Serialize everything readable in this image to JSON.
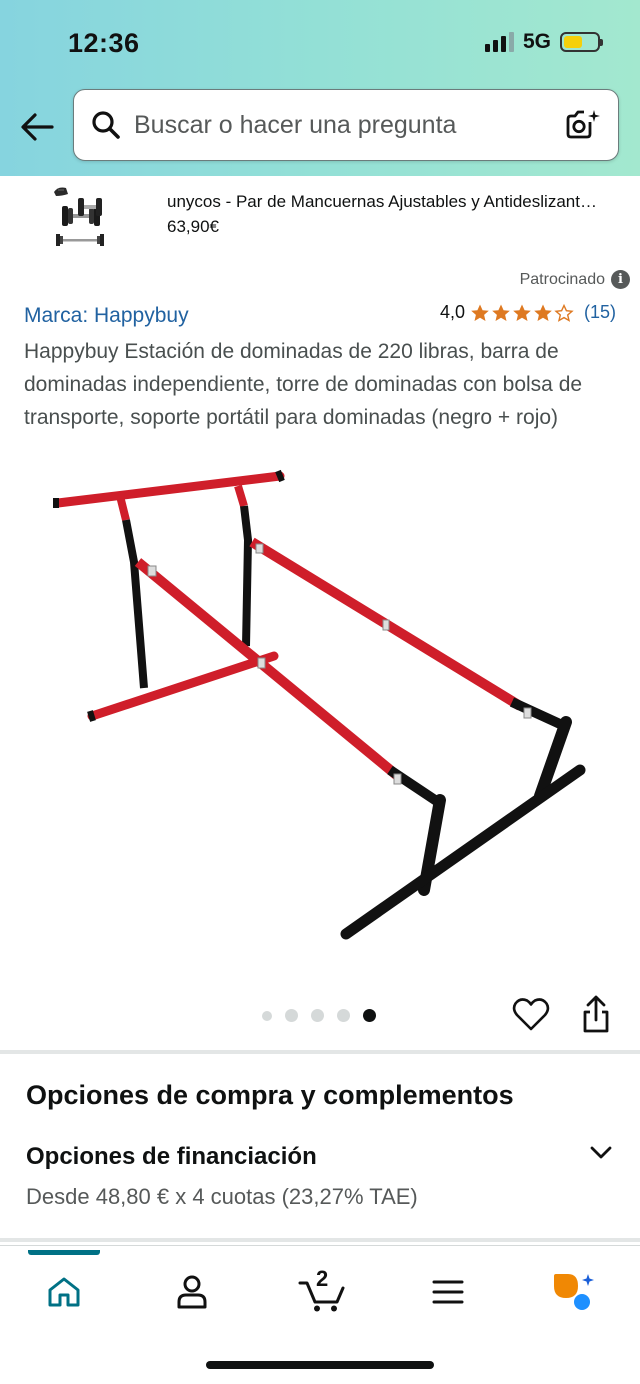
{
  "status_bar": {
    "time": "12:36",
    "network": "5G",
    "battery_color": "#f5d00a"
  },
  "search": {
    "placeholder": "Buscar o hacer una pregunta",
    "left_icon": "search-icon",
    "right_icon": "camera-icon"
  },
  "navigation": {
    "back_icon": "arrow-left-icon"
  },
  "related_product": {
    "title": "unycos - Par de Mancuernas Ajustables y Antideslizant…",
    "price": "63,90€",
    "thumbnail_icon": "dumbbells-icon"
  },
  "product": {
    "sponsored_label": "Patrocinado",
    "brand": "Marca: Happybuy",
    "rating_value": "4,0",
    "rating_stars": 4,
    "rating_count": "(15)",
    "title": "Happybuy Estación de dominadas de 220 libras, barra de dominadas independiente, torre de dominadas con bolsa de transporte, soporte portátil para dominadas (negro + rojo)",
    "image_icon": "pull-up-bar-station-icon",
    "carousel": {
      "total": 5,
      "active_index": 4
    },
    "star_color": "#de7921",
    "link_color": "#2162a1"
  },
  "purchase_options": {
    "section_title": "Opciones de compra y complementos",
    "financing_title": "Opciones de financiación",
    "financing_desc": "Desde 48,80 € x 4 cuotas (23,27% TAE)"
  },
  "bottom_nav": {
    "items": [
      {
        "name": "home",
        "icon": "home-icon",
        "active": true
      },
      {
        "name": "account",
        "icon": "person-icon"
      },
      {
        "name": "cart",
        "icon": "cart-icon",
        "badge": "2"
      },
      {
        "name": "menu",
        "icon": "menu-icon"
      },
      {
        "name": "rufus",
        "icon": "rufus-assistant-icon"
      }
    ],
    "active_color": "#007185"
  }
}
